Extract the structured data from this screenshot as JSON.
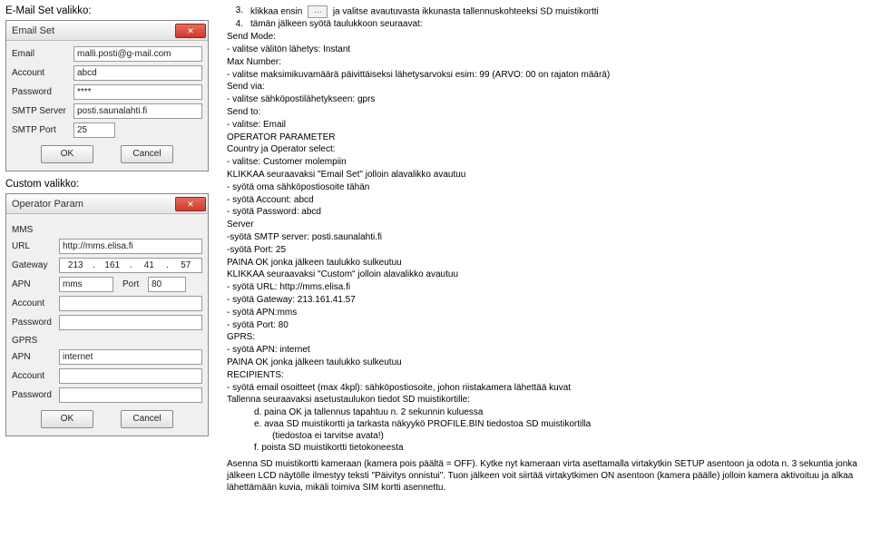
{
  "left": {
    "email_label": "E-Mail Set valikko:",
    "custom_label": "Custom valikko:"
  },
  "email_dlg": {
    "title": "Email Set",
    "email_lbl": "Email",
    "email_val": "malli.posti@g-mail.com",
    "account_lbl": "Account",
    "account_val": "abcd",
    "password_lbl": "Password",
    "password_val": "****",
    "smtp_lbl": "SMTP Server",
    "smtp_val": "posti.saunalahti.fi",
    "port_lbl": "SMTP Port",
    "port_val": "25",
    "ok": "OK",
    "cancel": "Cancel"
  },
  "op_dlg": {
    "title": "Operator Param",
    "mms_hd": "MMS",
    "url_lbl": "URL",
    "url_val": "http://mms.elisa.fi",
    "gw_lbl": "Gateway",
    "gw_a": "213",
    "gw_b": "161",
    "gw_c": "41",
    "gw_d": "57",
    "apn_lbl": "APN",
    "apn_val": "mms",
    "port_lbl": "Port",
    "port_val": "80",
    "acc_lbl": "Account",
    "pwd_lbl": "Password",
    "gprs_hd": "GPRS",
    "gapn_lbl": "APN",
    "gapn_val": "internet",
    "gacc_lbl": "Account",
    "gpwd_lbl": "Password",
    "ok": "OK",
    "cancel": "Cancel"
  },
  "instr": {
    "i3n": "3.",
    "i3t_a": "klikkaa ensin",
    "i3t_b": "ja valitse avautuvasta ikkunasta tallennuskohteeksi SD muistikortti",
    "i4n": "4.",
    "i4t": "tämän jälkeen syötä taulukkoon seuraavat:",
    "lines": [
      "Send Mode:",
      "- valitse välitön lähetys: Instant",
      "Max Number:",
      "- valitse maksimikuvamäärä päivittäiseksi lähetysarvoksi esim: 99 (ARVO: 00 on rajaton määrä)",
      "Send via:",
      "- valitse sähköpostilähetykseen: gprs",
      "Send to:",
      "- valitse: Email",
      "OPERATOR PARAMETER",
      "Country ja Operator select:",
      "- valitse: Customer molempiin",
      "KLIKKAA seuraavaksi \"Email Set\" jolloin alavalikko avautuu",
      "- syötä oma sähköpostiosoite tähän",
      "- syötä Account: abcd",
      " - syötä Password: abcd",
      "Server",
      "-syötä SMTP server: posti.saunalahti.fi",
      "-syötä Port: 25",
      "PAINA OK jonka jälkeen taulukko sulkeutuu",
      "KLIKKAA seuraavaksi \"Custom\" jolloin alavalikko avautuu",
      "- syötä URL: http://mms.elisa.fi",
      "- syötä Gateway: 213.161.41.57",
      "- syötä APN:mms",
      "- syötä Port: 80",
      "GPRS:",
      "- syötä APN: internet",
      "PAINA OK jonka jälkeen taulukko sulkeutuu",
      "RECIPIENTS:",
      "- syötä email osoitteet (max 4kpl): sähköpostiosoite, johon riistakamera lähettää kuvat",
      "Tallenna seuraavaksi asetustaulukon tiedot SD muistikortille:"
    ],
    "d": "d.   paina OK  ja tallennus tapahtuu n. 2 sekunnin kuluessa",
    "e": "e.   avaa SD muistikortti ja tarkasta näkyykö PROFILE.BIN tiedostoa SD muistikortilla",
    "e2": "(tiedostoa ei tarvitse avata!)",
    "f": "f.    poista SD muistikortti tietokoneesta",
    "final": "Asenna SD muistikortti kameraan (kamera pois päältä = OFF). Kytke nyt kameraan virta asettamalla virtakytkin SETUP asentoon ja odota n. 3 sekuntia jonka jälkeen LCD näytölle ilmestyy teksti \"Päivitys onnistui\". Tuon jälkeen voit siirtää virtakytkimen ON asentoon (kamera päälle) jolloin kamera aktivoituu ja alkaa lähettämään kuvia, mikäli toimiva SIM kortti asennettu."
  }
}
